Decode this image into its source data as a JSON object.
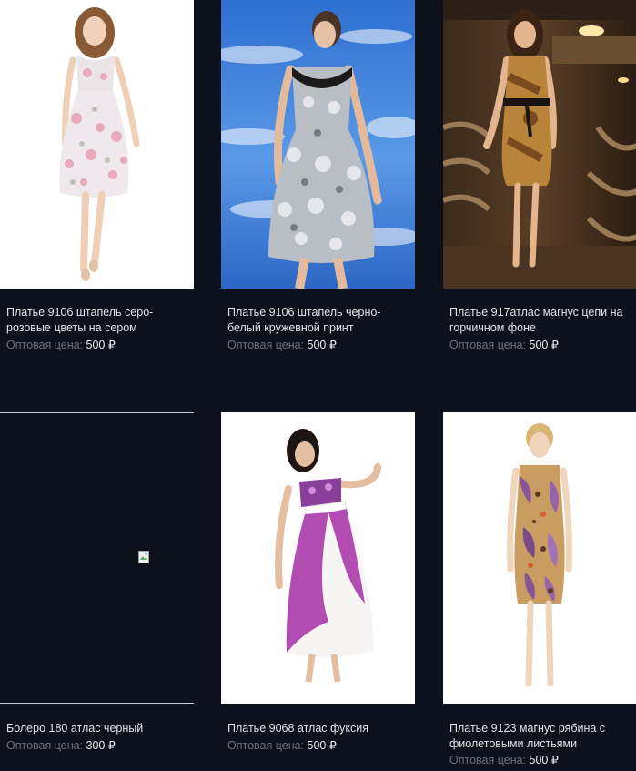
{
  "products": [
    {
      "title": "Платье 9106 штапель серо-розовые цветы на сером",
      "price_label": "Оптовая цена:",
      "price_value": "500",
      "currency": "₽",
      "image": "dress-floral-pink-grey-photo"
    },
    {
      "title": "Платье 9106 штапель черно-белый кружевной принт",
      "price_label": "Оптовая цена:",
      "price_value": "500",
      "currency": "₽",
      "image": "dress-black-white-lace-print-photo"
    },
    {
      "title": "Платье 917атлас магнус цепи на горчичном фоне",
      "price_label": "Оптовая цена:",
      "price_value": "500",
      "currency": "₽",
      "image": "dress-satin-chains-mustard-photo"
    },
    {
      "title": "Болеро 180 атлас черный",
      "price_label": "Оптовая цена:",
      "price_value": "300",
      "currency": "₽",
      "image": "broken-image-icon"
    },
    {
      "title": "Платье 9068 атлас фуксия",
      "price_label": "Оптовая цена:",
      "price_value": "500",
      "currency": "₽",
      "image": "dress-satin-fuchsia-photo"
    },
    {
      "title": "Платье 9123 магнус рябина с фиолетовыми листьями",
      "price_label": "Оптовая цена:",
      "price_value": "500",
      "currency": "₽",
      "image": "dress-rowan-violet-leaves-photo"
    }
  ],
  "colors": {
    "background": "#0c111b",
    "title_text": "#dfe3ea",
    "price_label": "#6b717c",
    "price_value": "#e8eaee"
  }
}
